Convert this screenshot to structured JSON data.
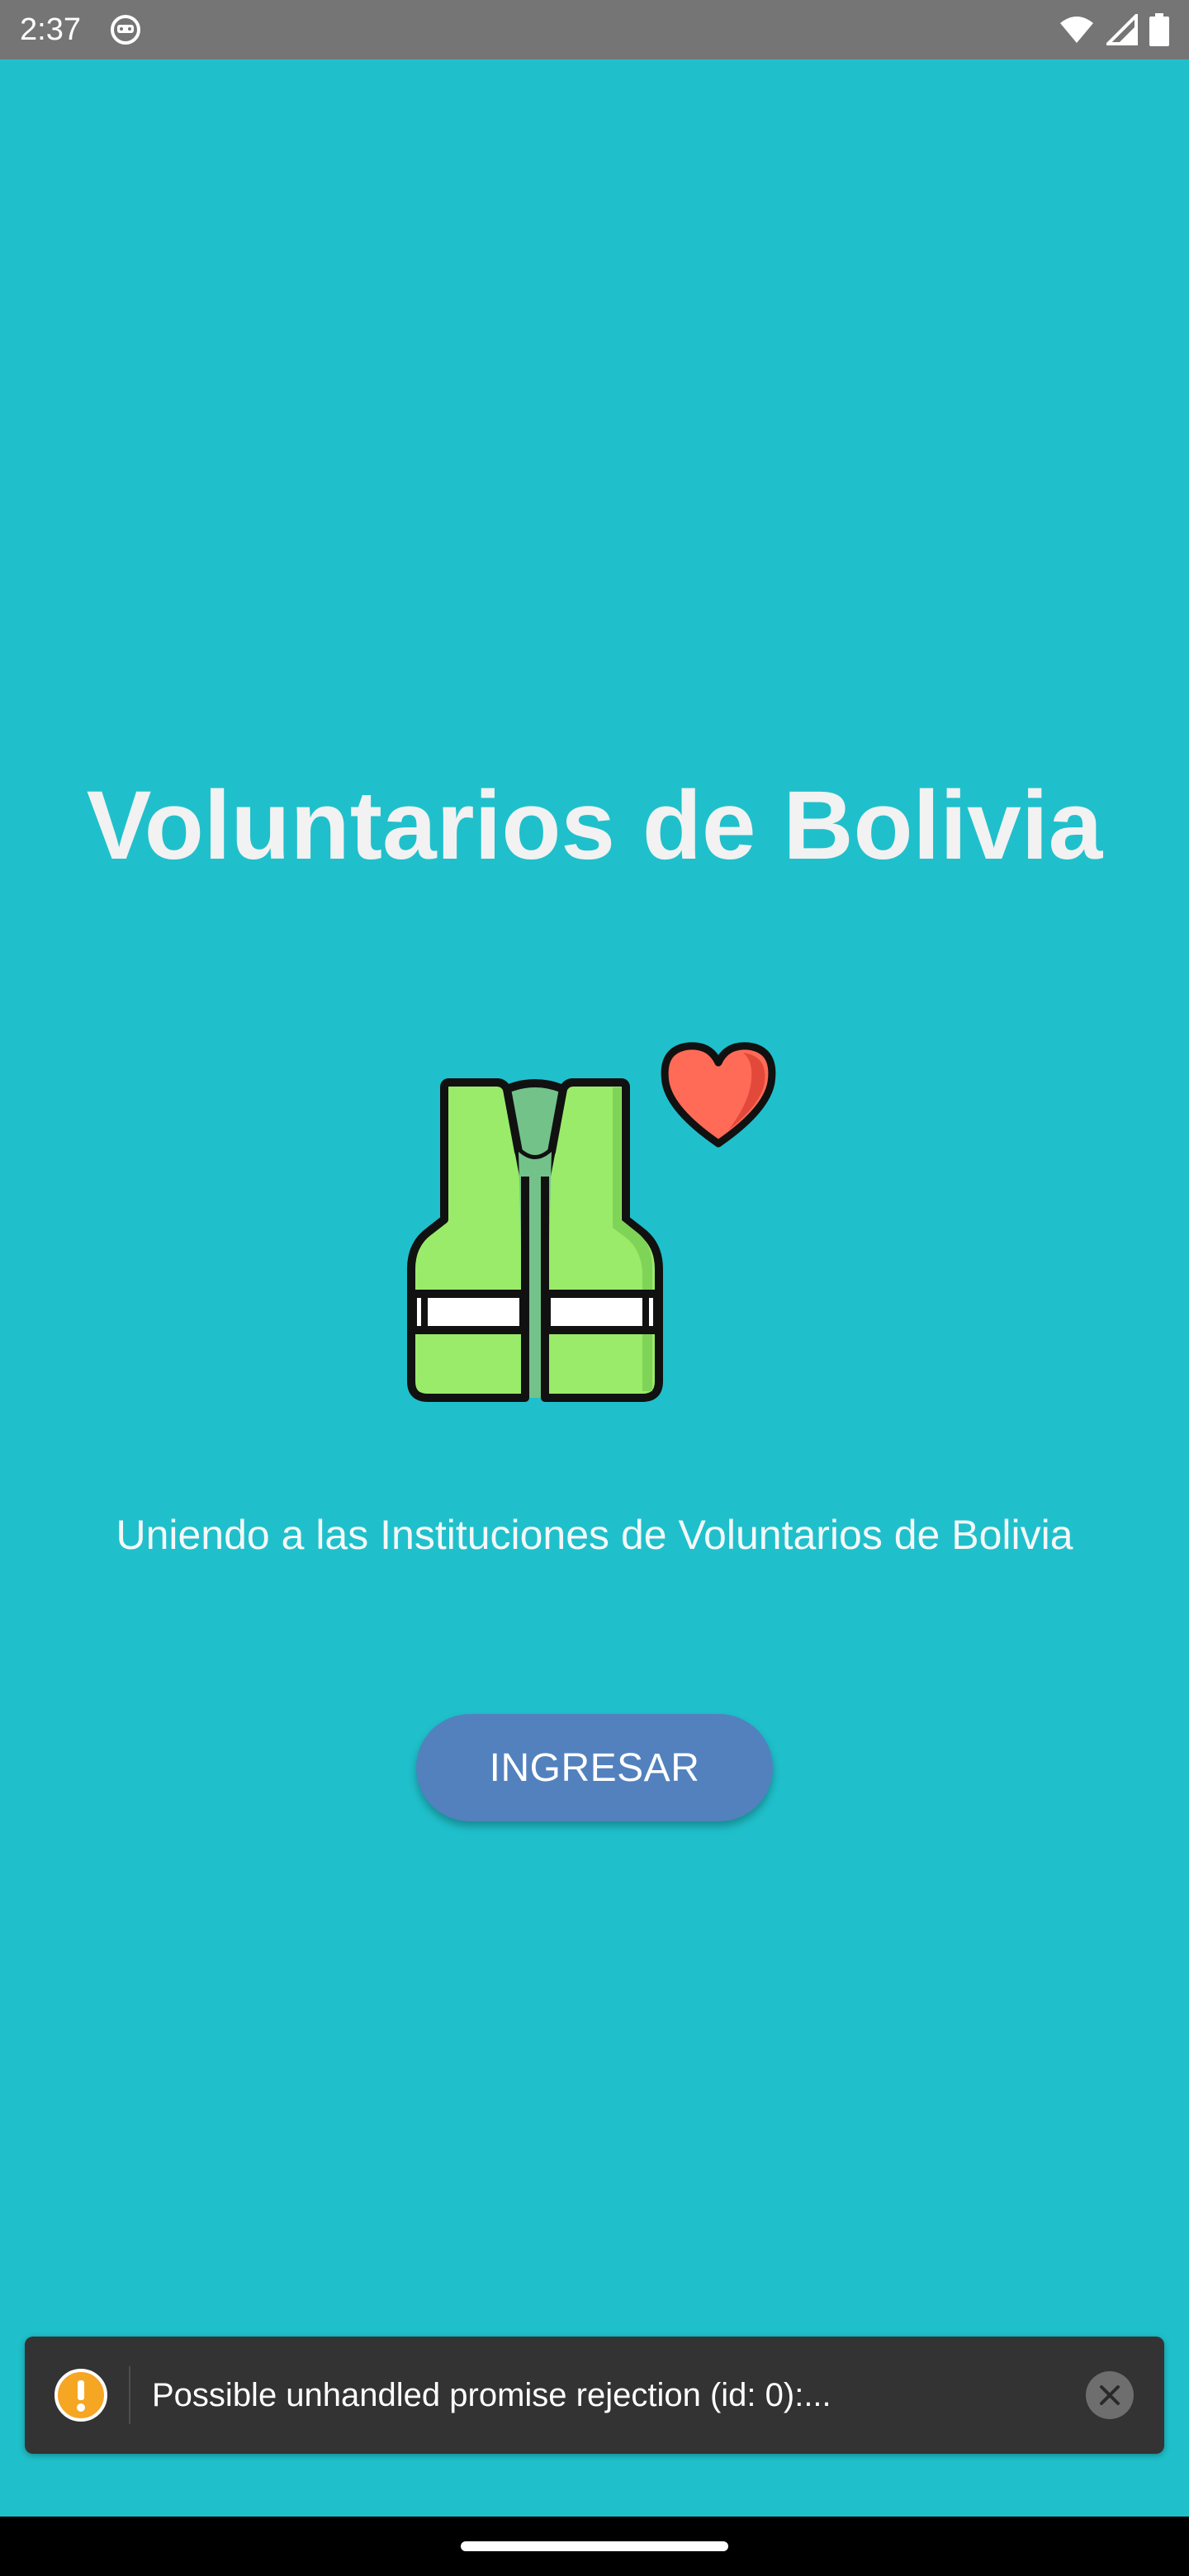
{
  "status_bar": {
    "time": "2:37",
    "app_icon": "android-debug-icon",
    "icons": [
      "wifi-icon",
      "cell-signal-icon",
      "battery-icon"
    ]
  },
  "main": {
    "title": "Voluntarios de Bolivia",
    "illustration": "volunteer-vest-with-heart-icon",
    "subtitle": "Uniendo a las Instituciones de Voluntarios de Bolivia",
    "button_label": "INGRESAR"
  },
  "toast": {
    "icon": "warning-icon",
    "message": "Possible unhandled promise rejection (id: 0):...",
    "close_icon": "close-icon"
  },
  "colors": {
    "background": "#1FC0CB",
    "button": "#5281BE",
    "toast": "#333333",
    "vest_green": "#9AEB6A",
    "heart": "#FF6B57"
  }
}
